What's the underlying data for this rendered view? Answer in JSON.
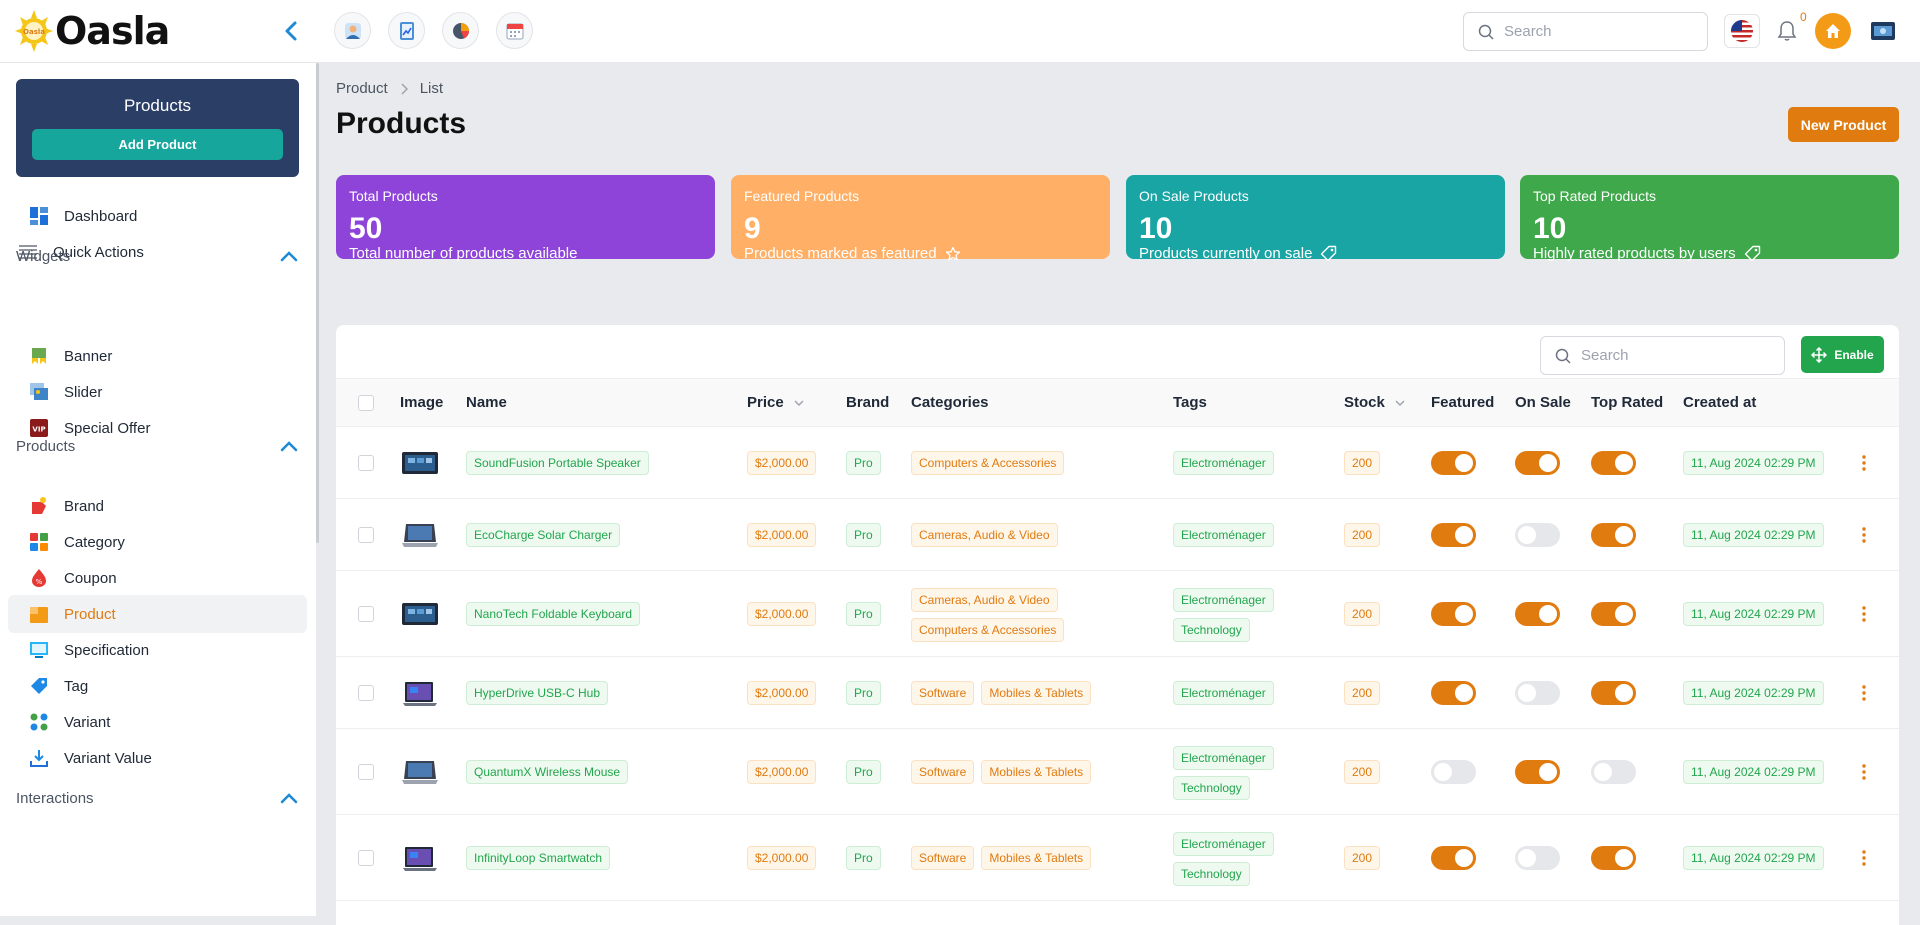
{
  "header": {
    "logo_text": "Oasla",
    "logo_badge": "Oasla",
    "search_placeholder": "Search",
    "notification_count": "0",
    "quick_icons": [
      "user-profile-icon",
      "report-icon",
      "analytics-pie-icon",
      "calendar-icon"
    ]
  },
  "sidebar": {
    "card_title": "Products",
    "add_button": "Add Product",
    "top_items": [
      {
        "label": "Dashboard",
        "icon": "dashboard-icon"
      },
      {
        "label": "Quick Actions",
        "icon": "list-icon"
      }
    ],
    "sections": [
      {
        "title": "Widgets",
        "items": [
          {
            "label": "Banner",
            "icon": "banner-icon"
          },
          {
            "label": "Slider",
            "icon": "slider-icon"
          },
          {
            "label": "Special Offer",
            "icon": "vip-icon"
          }
        ]
      },
      {
        "title": "Products",
        "items": [
          {
            "label": "Brand",
            "icon": "brand-icon"
          },
          {
            "label": "Category",
            "icon": "category-icon"
          },
          {
            "label": "Coupon",
            "icon": "coupon-icon"
          },
          {
            "label": "Product",
            "icon": "product-icon",
            "active": true
          },
          {
            "label": "Specification",
            "icon": "specification-icon"
          },
          {
            "label": "Tag",
            "icon": "tag-icon"
          },
          {
            "label": "Variant",
            "icon": "variant-icon"
          },
          {
            "label": "Variant Value",
            "icon": "variant-value-icon"
          }
        ]
      },
      {
        "title": "Interactions",
        "items": []
      }
    ]
  },
  "page": {
    "breadcrumb": [
      "Product",
      "List"
    ],
    "title": "Products",
    "new_button": "New Product"
  },
  "stats": [
    {
      "title": "Total Products",
      "value": "50",
      "desc": "Total number of products available",
      "color": "#8e44d8",
      "icon": ""
    },
    {
      "title": "Featured Products",
      "value": "9",
      "desc": "Products marked as featured",
      "color": "#ffaf66",
      "icon": "star-icon"
    },
    {
      "title": "On Sale Products",
      "value": "10",
      "desc": "Products currently on sale",
      "color": "#1aa5a5",
      "icon": "tag-icon"
    },
    {
      "title": "Top Rated Products",
      "value": "10",
      "desc": "Highly rated products by users",
      "color": "#3ea84a",
      "icon": "tag-icon"
    }
  ],
  "table": {
    "search_placeholder": "Search",
    "enable_label": "Enable",
    "columns": {
      "image": "Image",
      "name": "Name",
      "price": "Price",
      "brand": "Brand",
      "categories": "Categories",
      "tags": "Tags",
      "stock": "Stock",
      "featured": "Featured",
      "on_sale": "On Sale",
      "top_rated": "Top Rated",
      "created_at": "Created at"
    },
    "rows": [
      {
        "name": "SoundFusion Portable Speaker",
        "price": "$2,000.00",
        "brand": "Pro",
        "categories": [
          "Computers & Accessories"
        ],
        "cat_layout": "inline",
        "tags": [
          "Electroménager"
        ],
        "stock": "200",
        "featured": true,
        "on_sale": true,
        "top_rated": true,
        "created_at": "11, Aug 2024 02:29 PM",
        "thumb": "tablet"
      },
      {
        "name": "EcoCharge Solar Charger",
        "price": "$2,000.00",
        "brand": "Pro",
        "categories": [
          "Cameras, Audio & Video"
        ],
        "cat_layout": "inline",
        "tags": [
          "Electroménager"
        ],
        "stock": "200",
        "featured": true,
        "on_sale": false,
        "top_rated": true,
        "created_at": "11, Aug 2024 02:29 PM",
        "thumb": "laptop"
      },
      {
        "name": "NanoTech Foldable Keyboard",
        "price": "$2,000.00",
        "brand": "Pro",
        "categories": [
          "Cameras, Audio & Video",
          "Computers & Accessories"
        ],
        "cat_layout": "stack",
        "tags": [
          "Electroménager",
          "Technology"
        ],
        "stock": "200",
        "featured": true,
        "on_sale": true,
        "top_rated": true,
        "created_at": "11, Aug 2024 02:29 PM",
        "thumb": "tablet"
      },
      {
        "name": "HyperDrive USB-C Hub",
        "price": "$2,000.00",
        "brand": "Pro",
        "categories": [
          "Software",
          "Mobiles & Tablets"
        ],
        "cat_layout": "inline",
        "tags": [
          "Electroménager"
        ],
        "stock": "200",
        "featured": true,
        "on_sale": false,
        "top_rated": true,
        "created_at": "11, Aug 2024 02:29 PM",
        "thumb": "surface"
      },
      {
        "name": "QuantumX Wireless Mouse",
        "price": "$2,000.00",
        "brand": "Pro",
        "categories": [
          "Software",
          "Mobiles & Tablets"
        ],
        "cat_layout": "inline",
        "tags": [
          "Electroménager",
          "Technology"
        ],
        "stock": "200",
        "featured": false,
        "on_sale": true,
        "top_rated": false,
        "created_at": "11, Aug 2024 02:29 PM",
        "thumb": "laptop"
      },
      {
        "name": "InfinityLoop Smartwatch",
        "price": "$2,000.00",
        "brand": "Pro",
        "categories": [
          "Software",
          "Mobiles & Tablets"
        ],
        "cat_layout": "inline",
        "tags": [
          "Electroménager",
          "Technology"
        ],
        "stock": "200",
        "featured": true,
        "on_sale": false,
        "top_rated": true,
        "created_at": "11, Aug 2024 02:29 PM",
        "thumb": "surface"
      }
    ]
  }
}
